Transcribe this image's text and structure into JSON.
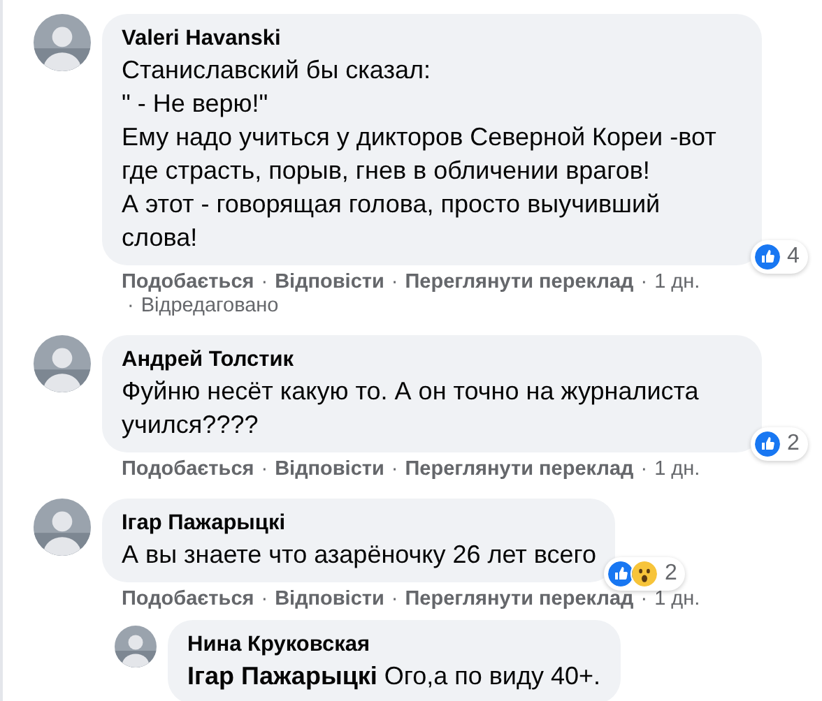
{
  "comments": [
    {
      "author": "Valeri Havanski",
      "avatar": {
        "kind": "picture"
      },
      "lines": [
        "Станиславский бы сказал:",
        "\" - Не верю!\"",
        "Ему надо учиться у дикторов Северной Кореи -вот где страсть, порыв, гнев в обличении врагов!",
        "А этот - говорящая голова, просто выучивший слова!"
      ],
      "reactions": {
        "types": [
          {
            "kind": "like"
          }
        ],
        "count": "4"
      },
      "meta": [
        "Подобається",
        "·",
        "Відповісти",
        "·",
        "Переглянути переклад",
        "·",
        "1 дн."
      ],
      "edited": [
        "·",
        "Відредаговано"
      ]
    },
    {
      "author": "Андрей Толстик",
      "avatar": {
        "kind": "picture"
      },
      "lines": [
        "Фуйню несёт какую то. А он точно на журналиста учился????"
      ],
      "reactions": {
        "types": [
          {
            "kind": "like"
          }
        ],
        "count": "2"
      },
      "meta": [
        "Подобається",
        "·",
        "Відповісти",
        "·",
        "Переглянути переклад",
        "·",
        "1 дн."
      ]
    },
    {
      "author": "Ігар Пажарыцкі",
      "avatar": {
        "kind": "picture"
      },
      "lines": [
        "А вы знаете что азарёночку 26 лет всего"
      ],
      "reactions": {
        "types": [
          {
            "kind": "like"
          },
          {
            "kind": "wow"
          }
        ],
        "count": "2"
      },
      "meta": [
        "Подобається",
        "·",
        "Відповісти",
        "·",
        "Переглянути переклад",
        "·",
        "1 дн."
      ],
      "replies": [
        {
          "author": "Нина Круковская",
          "avatar": {
            "kind": "picture"
          },
          "lines": [
            "**Ігар Пажарыцкі** Ого,а по виду 40+."
          ]
        }
      ]
    }
  ]
}
